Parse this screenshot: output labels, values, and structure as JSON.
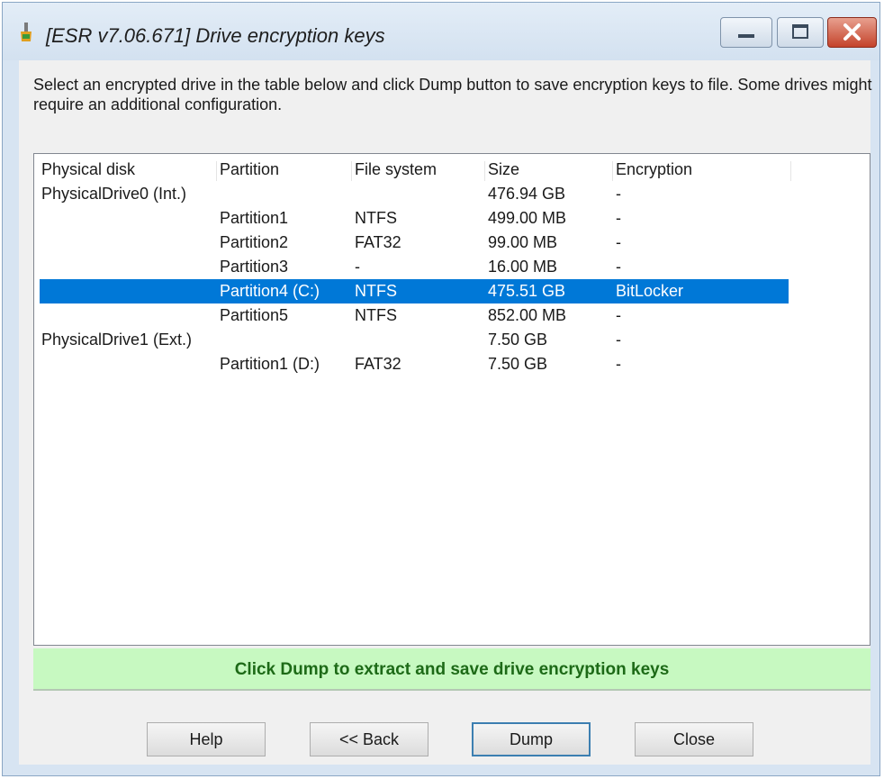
{
  "window": {
    "title": "[ESR v7.06.671]  Drive encryption keys",
    "controls": {
      "minimize_icon": "minimize-icon",
      "maximize_icon": "maximize-icon",
      "close_icon": "close-icon"
    }
  },
  "instruction": "Select an encrypted drive in the table below and click Dump button to save encryption keys to file. Some drives might require an additional configuration.",
  "table": {
    "columns": [
      "Physical disk",
      "Partition",
      "File system",
      "Size",
      "Encryption"
    ],
    "rows": [
      {
        "disk": "PhysicalDrive0 (Int.)",
        "partition": "",
        "fs": "",
        "size": "476.94 GB",
        "enc": "-"
      },
      {
        "disk": "",
        "partition": "Partition1",
        "fs": "NTFS",
        "size": "499.00 MB",
        "enc": "-"
      },
      {
        "disk": "",
        "partition": "Partition2",
        "fs": "FAT32",
        "size": "99.00 MB",
        "enc": "-"
      },
      {
        "disk": "",
        "partition": "Partition3",
        "fs": "-",
        "size": "16.00 MB",
        "enc": "-"
      },
      {
        "disk": "",
        "partition": "Partition4 (C:)",
        "fs": "NTFS",
        "size": "475.51 GB",
        "enc": "BitLocker",
        "selected": true
      },
      {
        "disk": "",
        "partition": "Partition5",
        "fs": "NTFS",
        "size": "852.00 MB",
        "enc": "-"
      },
      {
        "disk": "PhysicalDrive1 (Ext.)",
        "partition": "",
        "fs": "",
        "size": "7.50 GB",
        "enc": "-"
      },
      {
        "disk": "",
        "partition": "Partition1 (D:)",
        "fs": "FAT32",
        "size": "7.50 GB",
        "enc": "-"
      }
    ]
  },
  "status": "Click Dump to extract and save drive encryption keys",
  "buttons": {
    "help": "Help",
    "back": "<< Back",
    "dump": "Dump",
    "close": "Close"
  },
  "colors": {
    "selection": "#0078d7",
    "status_bg": "#c7f9c1",
    "status_text": "#1d6a17",
    "close_button": "#c4432b"
  }
}
